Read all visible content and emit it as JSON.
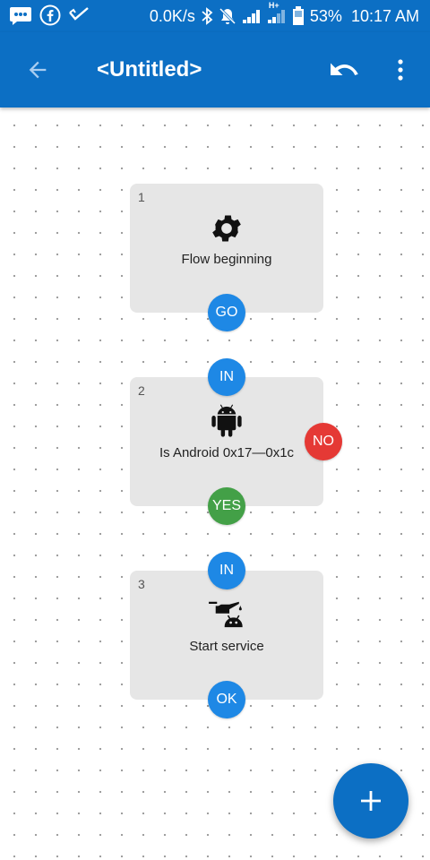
{
  "status_bar": {
    "speed": "0.0K/s",
    "network_label": "H+",
    "battery": "53%",
    "time": "10:17 AM",
    "icons": [
      "messages-icon",
      "facebook-icon",
      "check-icon",
      "bluetooth-icon",
      "mute-icon",
      "signal-icon",
      "signal-icon",
      "battery-icon"
    ]
  },
  "app_bar": {
    "title": "<Untitled>",
    "back_icon": "arrow-back-icon",
    "undo_icon": "undo-icon",
    "menu_icon": "more-vert-icon"
  },
  "blocks": [
    {
      "number": "1",
      "label": "Flow beginning",
      "icon": "gear-icon",
      "out_label": "GO"
    },
    {
      "number": "2",
      "label": "Is Android 0x17—0x1c",
      "icon": "android-icon",
      "in_label": "IN",
      "yes_label": "YES",
      "no_label": "NO"
    },
    {
      "number": "3",
      "label": "Start service",
      "icon": "service-oil-icon",
      "in_label": "IN",
      "ok_label": "OK"
    }
  ],
  "fab": {
    "icon": "plus-icon"
  },
  "colors": {
    "primary": "#0c6fc4",
    "connector_blue": "#1e88e5",
    "yes_green": "#43a047",
    "no_red": "#e53935",
    "block_bg": "#e6e6e6"
  }
}
